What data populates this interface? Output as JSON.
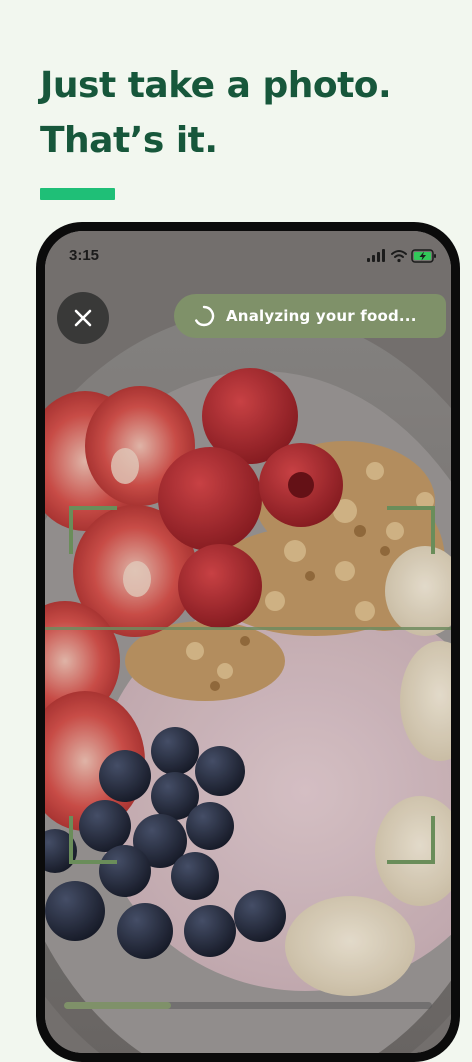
{
  "headline": {
    "line1": "Just take a photo.",
    "line2": "That’s it."
  },
  "colors": {
    "headline": "#17573b",
    "accent_bar": "#1fbf77",
    "analyze_pill": "#7f9169",
    "scan_frame": "#6a8d5a"
  },
  "phone": {
    "status_bar": {
      "time": "3:15",
      "icons": [
        "cellular-signal-icon",
        "wifi-icon",
        "battery-charging-icon"
      ]
    },
    "camera": {
      "close_icon": "close-icon",
      "status_text": "Analyzing your food...",
      "status_icon": "loading-spinner-icon",
      "scan_progress": 0.29
    }
  }
}
